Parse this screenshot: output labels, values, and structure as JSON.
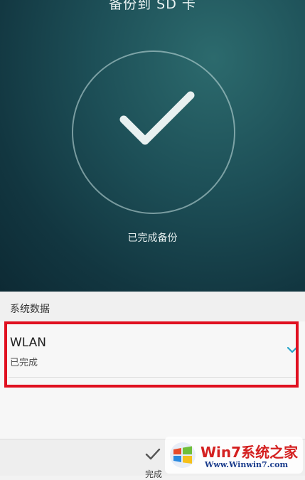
{
  "hero": {
    "title": "备份到 SD 卡",
    "status": "已完成备份"
  },
  "section": {
    "header": "系统数据"
  },
  "items": [
    {
      "title": "WLAN",
      "status": "已完成"
    }
  ],
  "bottom_bar": {
    "done_label": "完成"
  },
  "watermark": {
    "title": "Win7系统之家",
    "url": "Www.Winwin7.com"
  },
  "colors": {
    "accent": "#2aa6c9",
    "highlight": "#e01020",
    "hero_dark": "#0d2a34"
  }
}
